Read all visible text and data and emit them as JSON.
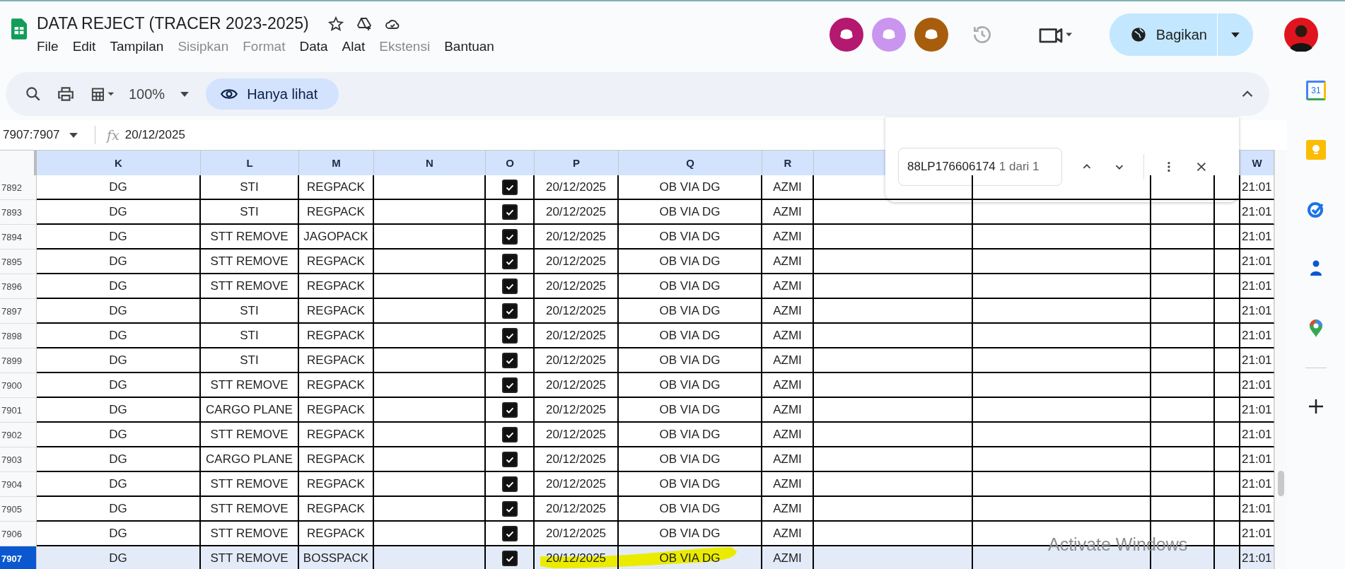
{
  "doc": {
    "title": "DATA REJECT (TRACER 2023-2025)"
  },
  "menu": [
    {
      "label": "File",
      "disabled": false
    },
    {
      "label": "Edit",
      "disabled": false
    },
    {
      "label": "Tampilan",
      "disabled": false
    },
    {
      "label": "Sisipkan",
      "disabled": true
    },
    {
      "label": "Format",
      "disabled": true
    },
    {
      "label": "Data",
      "disabled": false
    },
    {
      "label": "Alat",
      "disabled": false
    },
    {
      "label": "Ekstensi",
      "disabled": true
    },
    {
      "label": "Bantuan",
      "disabled": false
    }
  ],
  "collaborators": [
    {
      "color": "#b5186f"
    },
    {
      "color": "#c995ef"
    },
    {
      "color": "#a85d0c"
    }
  ],
  "share_button": {
    "label": "Bagikan"
  },
  "toolbar": {
    "zoom": "100%",
    "mode": "Hanya lihat"
  },
  "formula_bar": {
    "name_box": "7907:7907",
    "fx": "fx",
    "value": "20/12/2025"
  },
  "find": {
    "query": "88LP176606174",
    "count": "1 dari 1"
  },
  "column_headers": [
    "K",
    "L",
    "M",
    "N",
    "O",
    "P",
    "Q",
    "R",
    "W"
  ],
  "rows": [
    {
      "number": "7892",
      "column_k": "DG",
      "column_l": "STI",
      "column_m": "REGPACK",
      "checked": true,
      "column_p": "20/12/2025",
      "column_q": "OB VIA DG",
      "column_r": "AZMI",
      "column_w": "21:01",
      "selected": false,
      "highlighted": false
    },
    {
      "number": "7893",
      "column_k": "DG",
      "column_l": "STI",
      "column_m": "REGPACK",
      "checked": true,
      "column_p": "20/12/2025",
      "column_q": "OB VIA DG",
      "column_r": "AZMI",
      "column_w": "21:01",
      "selected": false,
      "highlighted": false
    },
    {
      "number": "7894",
      "column_k": "DG",
      "column_l": "STT REMOVE",
      "column_m": "JAGOPACK",
      "checked": true,
      "column_p": "20/12/2025",
      "column_q": "OB VIA DG",
      "column_r": "AZMI",
      "column_w": "21:01",
      "selected": false,
      "highlighted": false
    },
    {
      "number": "7895",
      "column_k": "DG",
      "column_l": "STT REMOVE",
      "column_m": "REGPACK",
      "checked": true,
      "column_p": "20/12/2025",
      "column_q": "OB VIA DG",
      "column_r": "AZMI",
      "column_w": "21:01",
      "selected": false,
      "highlighted": false
    },
    {
      "number": "7896",
      "column_k": "DG",
      "column_l": "STT REMOVE",
      "column_m": "REGPACK",
      "checked": true,
      "column_p": "20/12/2025",
      "column_q": "OB VIA DG",
      "column_r": "AZMI",
      "column_w": "21:01",
      "selected": false,
      "highlighted": false
    },
    {
      "number": "7897",
      "column_k": "DG",
      "column_l": "STI",
      "column_m": "REGPACK",
      "checked": true,
      "column_p": "20/12/2025",
      "column_q": "OB VIA DG",
      "column_r": "AZMI",
      "column_w": "21:01",
      "selected": false,
      "highlighted": false
    },
    {
      "number": "7898",
      "column_k": "DG",
      "column_l": "STI",
      "column_m": "REGPACK",
      "checked": true,
      "column_p": "20/12/2025",
      "column_q": "OB VIA DG",
      "column_r": "AZMI",
      "column_w": "21:01",
      "selected": false,
      "highlighted": false
    },
    {
      "number": "7899",
      "column_k": "DG",
      "column_l": "STI",
      "column_m": "REGPACK",
      "checked": true,
      "column_p": "20/12/2025",
      "column_q": "OB VIA DG",
      "column_r": "AZMI",
      "column_w": "21:01",
      "selected": false,
      "highlighted": false
    },
    {
      "number": "7900",
      "column_k": "DG",
      "column_l": "STT REMOVE",
      "column_m": "REGPACK",
      "checked": true,
      "column_p": "20/12/2025",
      "column_q": "OB VIA DG",
      "column_r": "AZMI",
      "column_w": "21:01",
      "selected": false,
      "highlighted": false
    },
    {
      "number": "7901",
      "column_k": "DG",
      "column_l": "CARGO PLANE",
      "column_m": "REGPACK",
      "checked": true,
      "column_p": "20/12/2025",
      "column_q": "OB VIA DG",
      "column_r": "AZMI",
      "column_w": "21:01",
      "selected": false,
      "highlighted": false
    },
    {
      "number": "7902",
      "column_k": "DG",
      "column_l": "STT REMOVE",
      "column_m": "REGPACK",
      "checked": true,
      "column_p": "20/12/2025",
      "column_q": "OB VIA DG",
      "column_r": "AZMI",
      "column_w": "21:01",
      "selected": false,
      "highlighted": false
    },
    {
      "number": "7903",
      "column_k": "DG",
      "column_l": "CARGO PLANE",
      "column_m": "REGPACK",
      "checked": true,
      "column_p": "20/12/2025",
      "column_q": "OB VIA DG",
      "column_r": "AZMI",
      "column_w": "21:01",
      "selected": false,
      "highlighted": false
    },
    {
      "number": "7904",
      "column_k": "DG",
      "column_l": "STT REMOVE",
      "column_m": "REGPACK",
      "checked": true,
      "column_p": "20/12/2025",
      "column_q": "OB VIA DG",
      "column_r": "AZMI",
      "column_w": "21:01",
      "selected": false,
      "highlighted": false
    },
    {
      "number": "7905",
      "column_k": "DG",
      "column_l": "STT REMOVE",
      "column_m": "REGPACK",
      "checked": true,
      "column_p": "20/12/2025",
      "column_q": "OB VIA DG",
      "column_r": "AZMI",
      "column_w": "21:01",
      "selected": false,
      "highlighted": false
    },
    {
      "number": "7906",
      "column_k": "DG",
      "column_l": "STT REMOVE",
      "column_m": "REGPACK",
      "checked": true,
      "column_p": "20/12/2025",
      "column_q": "OB VIA DG",
      "column_r": "AZMI",
      "column_w": "21:01",
      "selected": false,
      "highlighted": false
    },
    {
      "number": "7907",
      "column_k": "DG",
      "column_l": "STT REMOVE",
      "column_m": "BOSSPACK",
      "checked": true,
      "column_p": "20/12/2025",
      "column_q": "OB VIA DG",
      "column_r": "AZMI",
      "column_w": "21:01",
      "selected": true,
      "highlighted": true
    }
  ],
  "side_panel": {
    "calendar_day": "31"
  },
  "os_notice": "Activate Windows"
}
